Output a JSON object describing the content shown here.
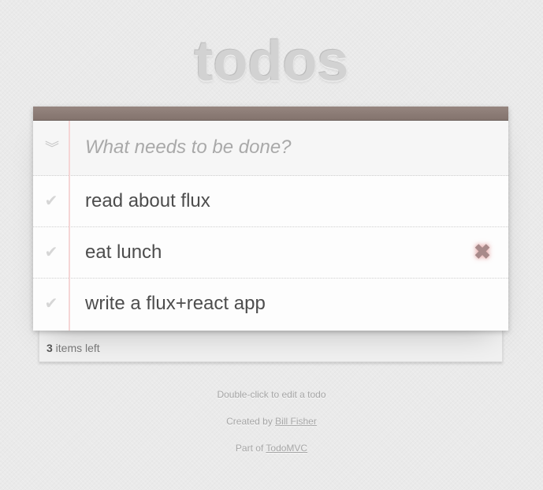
{
  "app": {
    "title": "todos"
  },
  "new_todo": {
    "placeholder": "What needs to be done?",
    "value": ""
  },
  "icons": {
    "toggle_all": "double-chevron-down-icon",
    "check": "check-icon",
    "destroy": "close-icon"
  },
  "todos": [
    {
      "label": "read about flux",
      "completed": false
    },
    {
      "label": "eat lunch",
      "completed": false
    },
    {
      "label": "write a flux+react app",
      "completed": false
    }
  ],
  "footer": {
    "count": "3",
    "count_suffix": " items left"
  },
  "info": {
    "edit_hint": "Double-click to edit a todo",
    "created_by_prefix": "Created by ",
    "created_by_name": "Bill Fisher",
    "part_of_prefix": "Part of ",
    "part_of_name": "TodoMVC"
  },
  "colors": {
    "header_bar": "#8d7d77",
    "margin_line": "#f5d6d6",
    "destroy": "#a88a8a"
  }
}
